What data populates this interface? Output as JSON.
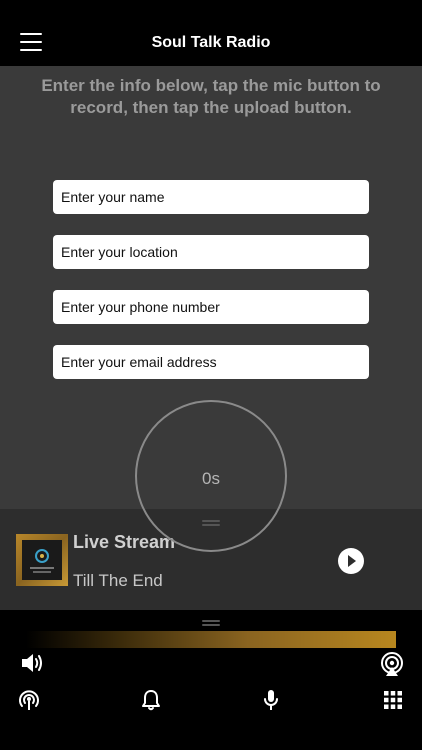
{
  "header": {
    "title": "Soul Talk Radio"
  },
  "instructions": "Enter the info below, tap the mic button to record, then tap the upload button.",
  "form": {
    "name_placeholder": "Enter your name",
    "location_placeholder": "Enter your location",
    "phone_placeholder": "Enter your phone number",
    "email_placeholder": "Enter your email address"
  },
  "recorder": {
    "timer": "0s"
  },
  "player": {
    "title": "Live Stream",
    "subtitle": "Till The End"
  },
  "volume": {
    "level": 1.0
  },
  "icons": {
    "menu": "hamburger-menu-icon",
    "play": "play-icon",
    "volume": "speaker-icon",
    "airplay": "airplay-icon",
    "radio": "broadcast-icon",
    "notifications": "bell-icon",
    "record": "microphone-icon",
    "more": "grid-icon"
  },
  "colors": {
    "accent": "#b8871f",
    "header_bg": "#000000",
    "page_bg": "#3a3a3a"
  }
}
